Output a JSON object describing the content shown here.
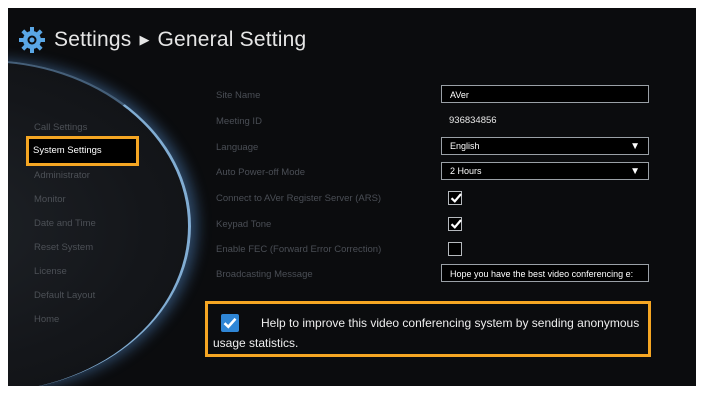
{
  "header": {
    "title": "Settings",
    "separator": "▶",
    "subtitle": "General Setting",
    "icon": "gear-icon"
  },
  "sidebar": {
    "items": [
      {
        "label": "Call Settings",
        "active": false
      },
      {
        "label": "System Settings",
        "active": true
      },
      {
        "label": "Administrator",
        "active": false
      },
      {
        "label": "Monitor",
        "active": false
      },
      {
        "label": "Date and Time",
        "active": false
      },
      {
        "label": "Reset System",
        "active": false
      },
      {
        "label": "License",
        "active": false
      },
      {
        "label": "Default Layout",
        "active": false
      },
      {
        "label": "Home",
        "active": false
      }
    ]
  },
  "settings": {
    "site_name": {
      "label": "Site Name",
      "value": "AVer"
    },
    "meeting_id": {
      "label": "Meeting ID",
      "value": "936834856"
    },
    "language": {
      "label": "Language",
      "value": "English"
    },
    "auto_power_off": {
      "label": "Auto Power-off Mode",
      "value": "2 Hours"
    },
    "ars": {
      "label": "Connect to AVer Register Server (ARS)",
      "checked": true
    },
    "keypad_tone": {
      "label": "Keypad Tone",
      "checked": true
    },
    "fec": {
      "label": "Enable FEC (Forward Error Correction)",
      "checked": false
    },
    "broadcasting": {
      "label": "Broadcasting Message",
      "value": "Hope you have the best video conferencing e:"
    }
  },
  "improve": {
    "checked": true,
    "text": "Help to improve this video conferencing system by sending anonymous usage statistics."
  },
  "colors": {
    "highlight": "#f5a623",
    "checkbox_blue": "#2f86d6",
    "background": "#0b0c0e"
  }
}
